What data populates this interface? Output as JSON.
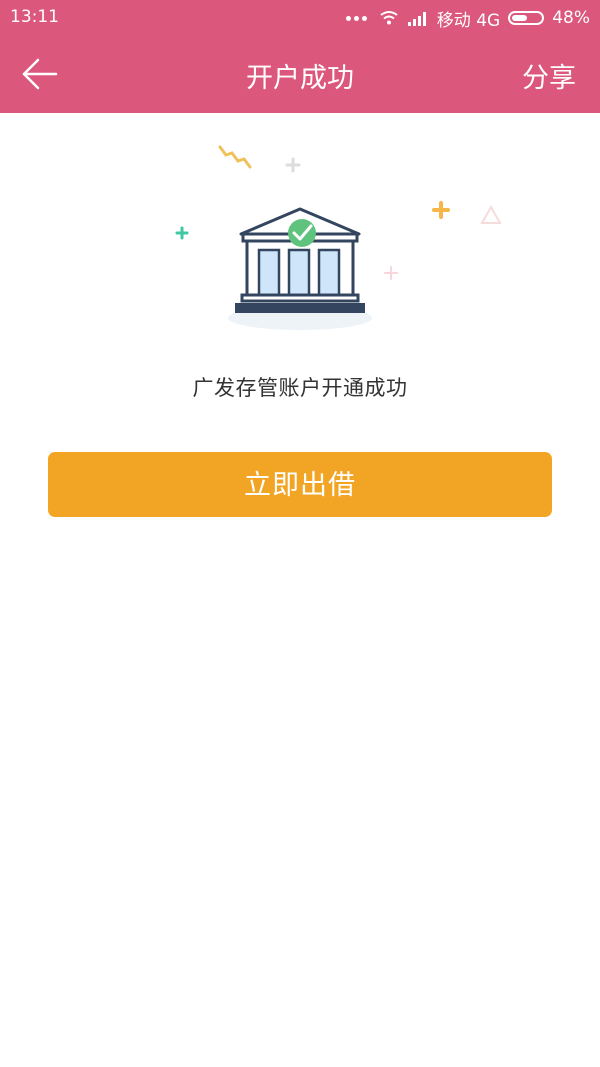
{
  "status_bar": {
    "time": "13:11",
    "carrier": "移动 4G",
    "battery": "48%",
    "battery_level": 0.48
  },
  "header": {
    "title": "开户成功",
    "back_icon": "back-arrow-icon",
    "share_label": "分享",
    "background_color": "#dc577c"
  },
  "main": {
    "message": "广发存管账户开通成功",
    "primary_button": "立即出借",
    "button_color": "#f2a524",
    "illustration_icon": "bank-check-icon"
  }
}
